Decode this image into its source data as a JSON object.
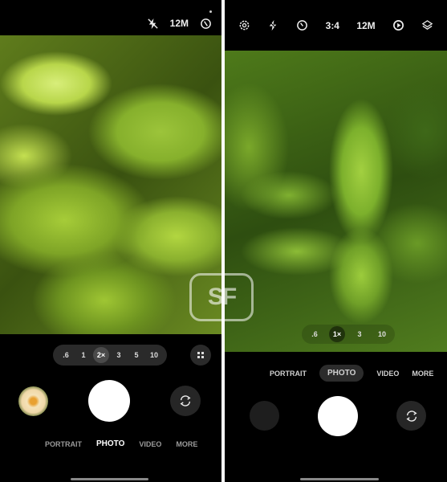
{
  "left_screen": {
    "top_bar": {
      "flash_icon": "flash-off-icon",
      "resolution": "12M",
      "timer_icon": "motion-photo-off-icon"
    },
    "zoom_options": [
      ".6",
      "1",
      "2×",
      "3",
      "5",
      "10"
    ],
    "zoom_active_index": 2,
    "grid_button_icon": "grid-icon",
    "gallery_thumbnail": "flower-thumbnail",
    "modes": [
      "PORTRAIT",
      "PHOTO",
      "VIDEO",
      "MORE"
    ],
    "active_mode": "PHOTO"
  },
  "right_screen": {
    "top_bar": {
      "settings_icon": "gear-icon",
      "flash_icon": "flash-icon",
      "timer_icon": "timer-icon",
      "aspect_ratio": "3:4",
      "resolution": "12M",
      "motion_icon": "motion-photo-icon",
      "filters_icon": "layers-icon"
    },
    "zoom_options": [
      ".6",
      "1×",
      "3",
      "10"
    ],
    "zoom_active_index": 1,
    "modes": [
      "PORTRAIT",
      "PHOTO",
      "VIDEO",
      "MORE"
    ],
    "active_mode": "PHOTO"
  },
  "watermark": {
    "text": "SF"
  }
}
